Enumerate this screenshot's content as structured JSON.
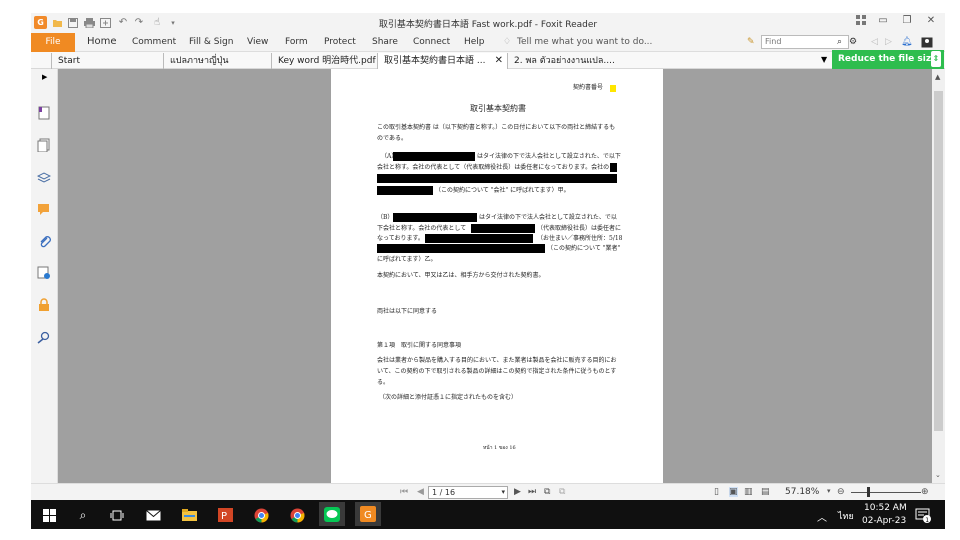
{
  "window": {
    "title": "取引基本契約書日本語  Fast work.pdf - Foxit Reader",
    "app_icon": "foxit-logo",
    "accent": "#f08a22"
  },
  "ribbon": {
    "file_label": "File",
    "tabs": [
      "Home",
      "Comment",
      "Fill & Sign",
      "View",
      "Form",
      "Protect",
      "Share",
      "Connect",
      "Help"
    ],
    "tell_me": "Tell me what you want to do...",
    "find_placeholder": "Find"
  },
  "doc_tabs": [
    {
      "label": "Start"
    },
    {
      "label": "แปลภาษาญี่ปุ่น"
    },
    {
      "label": "Key word  明治時代.pdf"
    },
    {
      "label": "取引基本契約書日本語  ..."
    },
    {
      "label": "2. พล ตัวอย่างงานแปล...."
    }
  ],
  "reduce_button": {
    "label": "Reduce the file size",
    "color": "#2ebd4e"
  },
  "document": {
    "contract_number_label": "契約書番号",
    "title": "取引基本契約書",
    "intro_1": "この取引基本契約書 は（以下契約書と称す。）この日付において以下の両社と締結するも",
    "intro_2": "のである。",
    "a_label": "（A）",
    "a_line1_tail": "はタイ法律の下で法人会社として設立された、で以下",
    "a_line2": "会社と称す。会社の代表として（代表取締役社長）は委任者になっております。会社の",
    "a_line4": "（この契約について \"会社\" に呼ばれてます）甲。",
    "b_label": "（B）",
    "b_line1_tail": "はタイ法律の下で法人会社として設立された、で以",
    "b_line2_head": "下会社と称す。会社の代表として",
    "b_line2_tail": "（代表取締役社長）は委任者に",
    "b_line3_head": "なっております。",
    "b_line3_tail": "（お住まい／事務所住所：5/18",
    "b_line4_tail": "（この契約について \"業者\"",
    "b_line5": "に呼ばれてます）乙。",
    "para_received": "本契約において、甲又は乙は、相手方から交付された契約書。",
    "para_agree": "両社は以下に同意する",
    "section_1_title": "第１項　取引に関する同意事項",
    "section_1_line1": "会社は業者から製品を購入する目的において、また業者は製品を会社に販売する目的にお",
    "section_1_line2": "いて、この契約の下で取引される製品の詳細はこの契約で指定された条件に従うものとす",
    "section_1_line3": "る。",
    "section_1_line4": "（次の詳細と添付証憑１に指定されたものを含む）",
    "footer_mark": "หน้า 1 ของ 16"
  },
  "status": {
    "page_value": "1 / 16",
    "zoom": "57.18%"
  },
  "taskbar": {
    "icons": [
      "windows-start-icon",
      "search-icon",
      "task-view-icon",
      "mail-icon",
      "file-explorer-icon",
      "powerpoint-icon",
      "chrome-icon",
      "chrome-profile-icon",
      "line-icon",
      "foxit-taskbar-icon"
    ],
    "language": "ไทย",
    "time": "10:52 AM",
    "date": "02-Apr-23",
    "notification_count": "1"
  }
}
